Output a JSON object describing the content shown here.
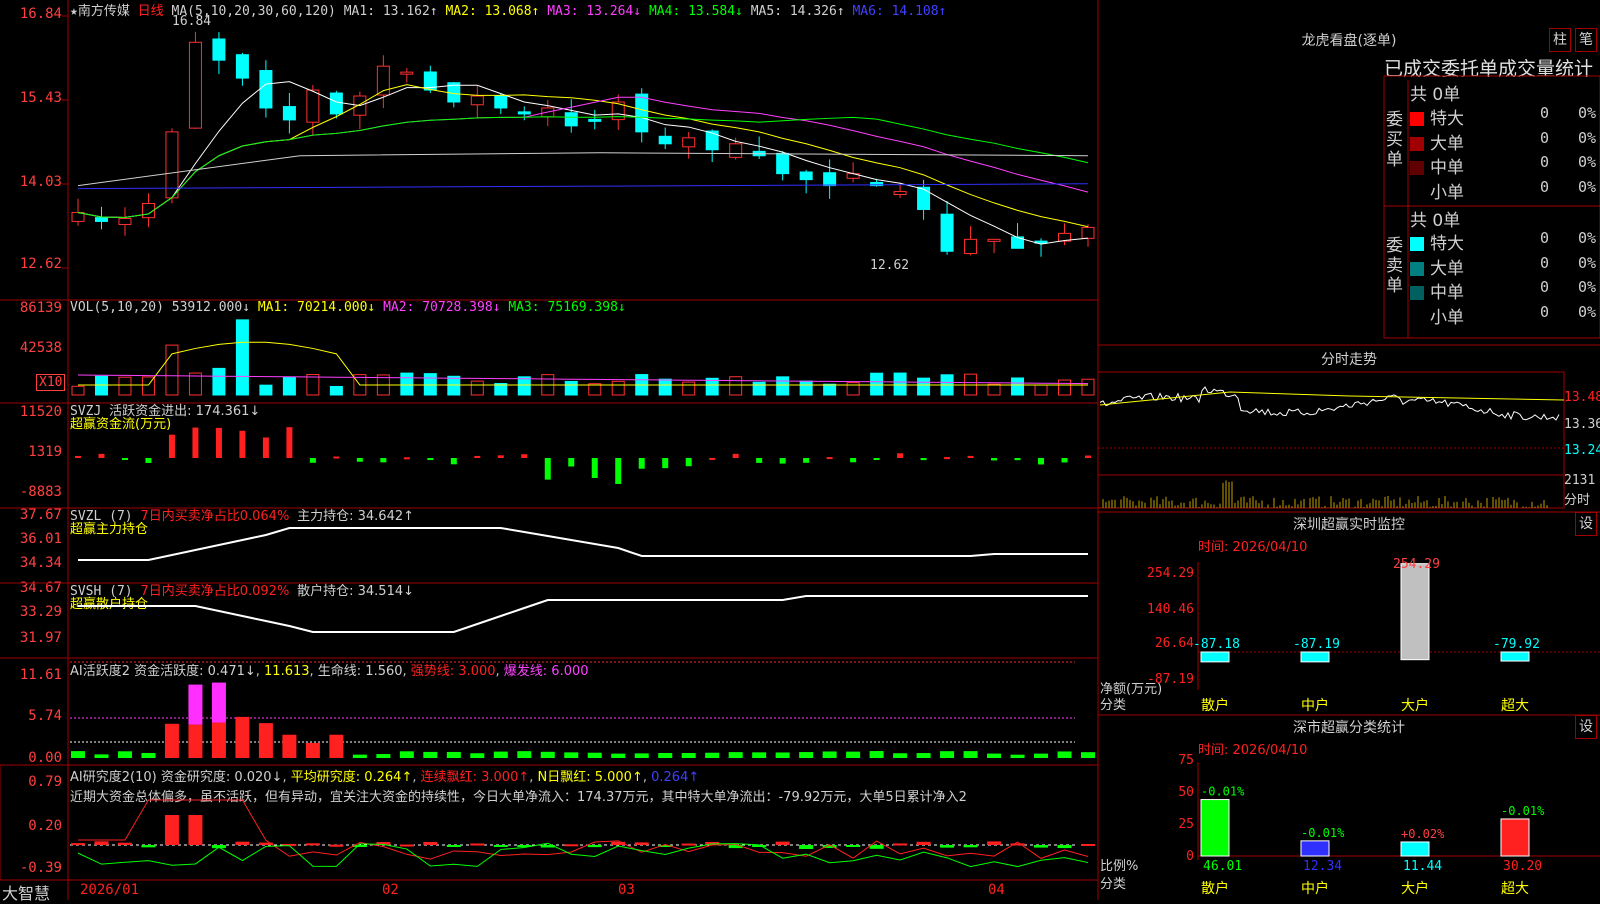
{
  "main": {
    "stock_name": "南方传媒",
    "period": "日线",
    "ma_label": "MA(5,10,20,30,60,120)",
    "ma1": "MA1: 13.162↑",
    "ma2": "MA2: 13.068↑",
    "ma3": "MA3: 13.264↓",
    "ma4": "MA4: 13.584↓",
    "ma5": "MA5: 14.326↑",
    "ma6": "MA6: 14.108↑",
    "high_mark": "16.84",
    "low_mark": "12.62",
    "y_ticks": [
      "16.84",
      "15.43",
      "14.03",
      "12.62"
    ]
  },
  "vol": {
    "label": "VOL(5,10,20)",
    "value": "53912.000↓",
    "ma1": "MA1: 70214.000↓",
    "ma2": "MA2: 70728.398↓",
    "ma3": "MA3: 75169.398↓",
    "y_ticks": [
      "86139",
      "42538"
    ],
    "unit": "X10"
  },
  "svzj": {
    "label": "SVZJ",
    "title": "活跃资金进出: 174.361↓",
    "sub": "超赢资金流(万元)",
    "y_ticks": [
      "11520",
      "1319",
      "-8883"
    ]
  },
  "svzl": {
    "label": "SVZL (7)",
    "ratio": "7日内买卖净占比0.064%",
    "hold": "主力持仓: 34.642↑",
    "sub": "超赢主力持仓",
    "y_ticks": [
      "37.67",
      "36.01",
      "34.34"
    ]
  },
  "svsh": {
    "label": "SVSH (7)",
    "ratio": "7日内买卖净占比0.092%",
    "hold": "散户持仓: 34.514↓",
    "sub": "超赢散户持仓",
    "y_ticks": [
      "34.67",
      "33.29",
      "31.97"
    ]
  },
  "ai_active": {
    "label": "AI活跃度2",
    "v1": "资金活跃度: 0.471↓",
    "v2": "11.613",
    "v3": "生命线: 1.560",
    "v4": "强势线: 3.000",
    "v5": "爆发线: 6.000",
    "y_ticks": [
      "11.61",
      "5.74",
      "0.00"
    ]
  },
  "ai_research": {
    "label": "AI研究度2(10)",
    "v1": "资金研究度: 0.020↓",
    "v2": "平均研究度: 0.264↑",
    "v3": "连续飘红: 3.000↑",
    "v4": "N日飘红: 5.000↑",
    "v5": "0.264↑",
    "comment": "近期大资金总体偏多，虽不活跃，但有异动，宜关注大资金的持续性，今日大单净流入：174.37万元，其中特大单净流出：-79.92万元，大单5日累计净入2",
    "y_ticks": [
      "0.79",
      "0.20",
      "-0.39"
    ]
  },
  "xaxis": {
    "brand": "大智慧",
    "labels": [
      "2026/01",
      "02",
      "03",
      "04"
    ]
  },
  "longhu": {
    "title": "龙虎看盘(逐单)",
    "btn_bar": "柱",
    "btn_pen": "笔",
    "header": "已成交委托单成交量统计",
    "buy_label": "委买单",
    "sell_label": "委卖单",
    "buy_total": "共 0单",
    "sell_total": "共 0单",
    "buy_rows": [
      {
        "name": "特大",
        "count": "0",
        "pct": "0%",
        "color": "#ff0000"
      },
      {
        "name": "大单",
        "count": "0",
        "pct": "0%",
        "color": "#a00000"
      },
      {
        "name": "中单",
        "count": "0",
        "pct": "0%",
        "color": "#600000"
      },
      {
        "name": "小单",
        "count": "0",
        "pct": "0%",
        "color": "#000000"
      }
    ],
    "sell_rows": [
      {
        "name": "特大",
        "count": "0",
        "pct": "0%",
        "color": "#00ffff"
      },
      {
        "name": "大单",
        "count": "0",
        "pct": "0%",
        "color": "#008080"
      },
      {
        "name": "中单",
        "count": "0",
        "pct": "0%",
        "color": "#006060"
      },
      {
        "name": "小单",
        "count": "0",
        "pct": "0%",
        "color": "#000000"
      }
    ]
  },
  "intraday": {
    "title": "分时走势",
    "prices": [
      "13.48",
      "13.36",
      "13.24"
    ],
    "vol": "2131",
    "vol_unit": "分时"
  },
  "sz_monitor": {
    "title": "深圳超赢实时监控",
    "btn": "设",
    "time": "时间: 2026/04/10",
    "y_ticks": [
      "254.29",
      "140.46",
      "26.64",
      "-87.19"
    ],
    "ylabel": "净额(万元)",
    "xlabel": "分类",
    "categories": [
      "散户",
      "中户",
      "大户",
      "超大"
    ],
    "values": [
      -87.18,
      -87.19,
      254.29,
      -79.92
    ],
    "value_labels": [
      "-87.18",
      "-87.19",
      "254.29",
      "-79.92"
    ]
  },
  "sz_class": {
    "title": "深市超赢分类统计",
    "btn": "设",
    "time": "时间: 2026/04/10",
    "y_ticks": [
      "75",
      "50",
      "25",
      "0"
    ],
    "ylabel": "比例%",
    "xlabel": "分类",
    "categories": [
      "散户",
      "中户",
      "大户",
      "超大"
    ],
    "values": [
      46.01,
      12.34,
      11.44,
      30.2
    ],
    "value_labels": [
      "46.01",
      "12.34",
      "11.44",
      "30.20"
    ],
    "change_labels": [
      "-0.01%",
      "-0.01%",
      "+0.02%",
      "-0.01%"
    ]
  },
  "colors": {
    "up": "#ff3030",
    "down": "#00ffff",
    "grid": "#a00000"
  }
}
